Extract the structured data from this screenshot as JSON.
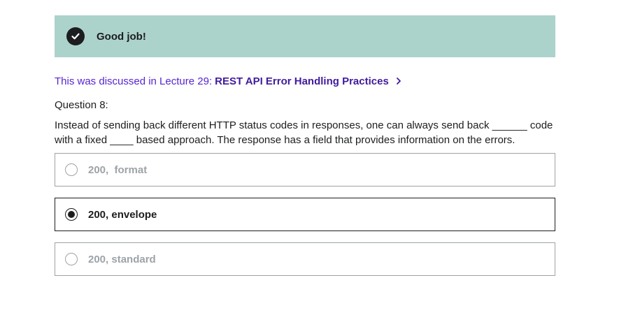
{
  "banner": {
    "text": "Good job!",
    "icon": "check-circle-icon",
    "background": "#acd2cc"
  },
  "lecture": {
    "prefix": "This was discussed in Lecture 29:",
    "link_text": "REST API Error Handling Practices",
    "icon": "chevron-right-icon"
  },
  "question": {
    "label": "Question 8:",
    "text": "Instead of sending back different HTTP status codes in responses, one can always send back ______ code with a fixed ____ based approach. The response has a field that provides information on the errors."
  },
  "options": [
    {
      "label": "200,  format",
      "selected": false
    },
    {
      "label": "200, envelope",
      "selected": true
    },
    {
      "label": "200, standard",
      "selected": false
    }
  ],
  "colors": {
    "accent_purple": "#5624d0",
    "dark": "#1c1d1f",
    "muted": "#9da3a7"
  }
}
